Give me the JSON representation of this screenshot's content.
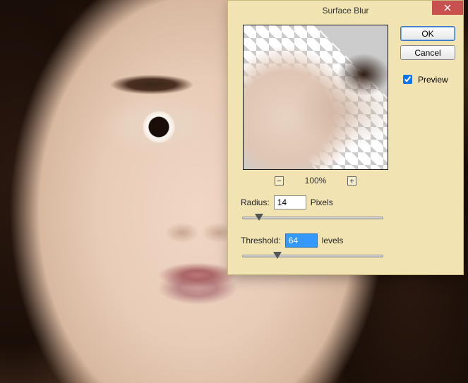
{
  "dialog": {
    "title": "Surface Blur",
    "ok_label": "OK",
    "cancel_label": "Cancel",
    "preview_label": "Preview",
    "preview_checked": true,
    "zoom": {
      "minus": "⊟",
      "plus": "⊞",
      "value": "100%"
    },
    "radius": {
      "label": "Radius:",
      "value": "14",
      "unit": "Pixels",
      "min": 1,
      "max": 100,
      "thumb_percent": 12
    },
    "threshold": {
      "label": "Threshold:",
      "value": "64",
      "unit": "levels",
      "min": 2,
      "max": 255,
      "thumb_percent": 25
    }
  }
}
